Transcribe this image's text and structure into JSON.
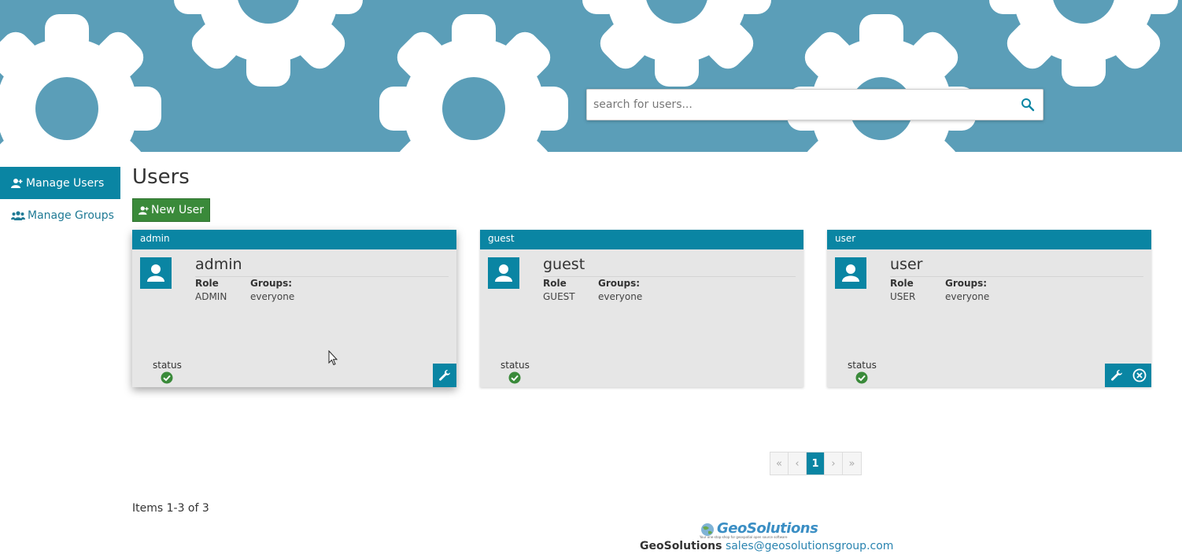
{
  "colors": {
    "banner": "#5b9eb8",
    "accent": "#0a85a3",
    "new_user_button": "#3a8a3a",
    "status_ok": "#3a8a3a",
    "link": "#2a84b0"
  },
  "search": {
    "placeholder": "search for users...",
    "icon": "search-icon"
  },
  "nav": {
    "items": [
      {
        "label": "Manage Users",
        "icon": "user-add-icon",
        "active": true
      },
      {
        "label": "Manage Groups",
        "icon": "group-icon",
        "active": false
      }
    ]
  },
  "page": {
    "title": "Users",
    "new_user_label": "New User"
  },
  "cards": [
    {
      "header": "admin",
      "name": "admin",
      "role_label": "Role",
      "role": "ADMIN",
      "groups_label": "Groups:",
      "groups": "everyone",
      "status_label": "status",
      "status": "active",
      "actions": [
        "edit"
      ]
    },
    {
      "header": "guest",
      "name": "guest",
      "role_label": "Role",
      "role": "GUEST",
      "groups_label": "Groups:",
      "groups": "everyone",
      "status_label": "status",
      "status": "active",
      "actions": []
    },
    {
      "header": "user",
      "name": "user",
      "role_label": "Role",
      "role": "USER",
      "groups_label": "Groups:",
      "groups": "everyone",
      "status_label": "status",
      "status": "active",
      "actions": [
        "edit",
        "delete"
      ]
    }
  ],
  "pagination": {
    "first": "«",
    "prev": "‹",
    "current": "1",
    "next": "›",
    "last": "»"
  },
  "items_count": "Items 1-3 of 3",
  "footer": {
    "logo_text": "GeoSolutions",
    "tagline": "Your one-stop-shop for geospatial open source software",
    "company": "GeoSolutions",
    "email": "sales@geosolutionsgroup.com"
  }
}
